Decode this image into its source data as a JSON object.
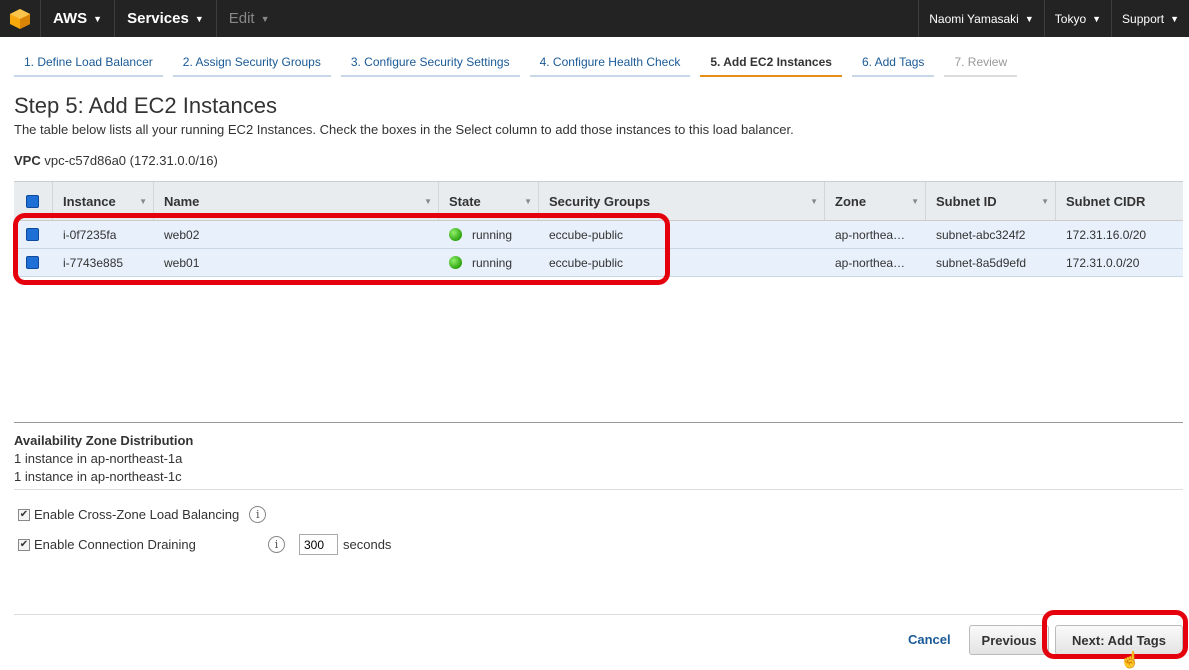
{
  "nav": {
    "logo_icon": "aws-cube-icon",
    "aws_label": "AWS",
    "services_label": "Services",
    "edit_label": "Edit",
    "user_label": "Naomi Yamasaki",
    "region_label": "Tokyo",
    "support_label": "Support"
  },
  "tabs": [
    {
      "label": "1. Define Load Balancer"
    },
    {
      "label": "2. Assign Security Groups"
    },
    {
      "label": "3. Configure Security Settings"
    },
    {
      "label": "4. Configure Health Check"
    },
    {
      "label": "5. Add EC2 Instances"
    },
    {
      "label": "6. Add Tags"
    },
    {
      "label": "7. Review"
    }
  ],
  "page": {
    "title": "Step 5: Add EC2 Instances",
    "description": "The table below lists all your running EC2 Instances. Check the boxes in the Select column to add those instances to this load balancer.",
    "vpc_label": "VPC",
    "vpc_value": "vpc-c57d86a0 (172.31.0.0/16)"
  },
  "table": {
    "columns": [
      "Instance",
      "Name",
      "State",
      "Security Groups",
      "Zone",
      "Subnet ID",
      "Subnet CIDR"
    ],
    "rows": [
      {
        "instance": "i-0f7235fa",
        "name": "web02",
        "state": "running",
        "sg": "eccube-public",
        "zone": "ap-northea…",
        "subnet": "subnet-abc324f2",
        "cidr": "172.31.16.0/20"
      },
      {
        "instance": "i-7743e885",
        "name": "web01",
        "state": "running",
        "sg": "eccube-public",
        "zone": "ap-northea…",
        "subnet": "subnet-8a5d9efd",
        "cidr": "172.31.0.0/20"
      }
    ]
  },
  "az": {
    "heading": "Availability Zone Distribution",
    "line1": "1 instance in ap-northeast-1a",
    "line2": "1 instance in ap-northeast-1c"
  },
  "options": {
    "cross_zone_label": "Enable Cross-Zone Load Balancing",
    "draining_label": "Enable Connection Draining",
    "draining_value": "300",
    "draining_unit": "seconds",
    "info_glyph": "i"
  },
  "footer": {
    "cancel_label": "Cancel",
    "previous_label": "Previous",
    "next_label": "Next: Add Tags"
  },
  "colors": {
    "highlight": "#e5000d",
    "accent_tab": "#e48f1a"
  }
}
